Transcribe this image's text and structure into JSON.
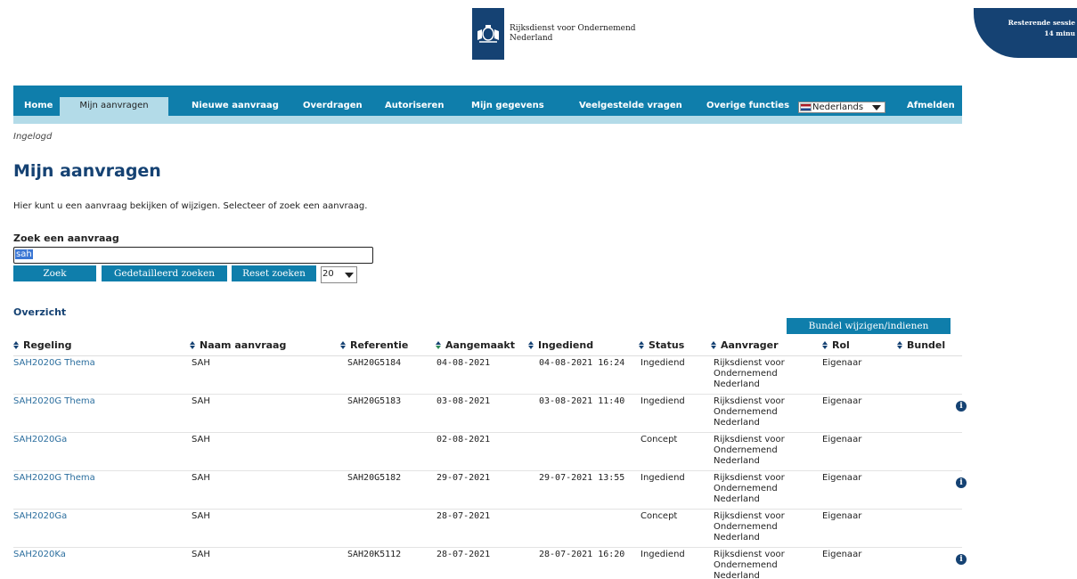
{
  "header": {
    "logo_line1": "Rijksdienst voor Ondernemend",
    "logo_line2": "Nederland",
    "session_line1": "Resterende sessie",
    "session_line2": "14 minu"
  },
  "nav": {
    "items": [
      "Home",
      "Mijn aanvragen",
      "Nieuwe aanvraag",
      "Overdragen",
      "Autoriseren",
      "Mijn gegevens",
      "Veelgestelde vragen",
      "Overige functies",
      "Afmelden"
    ],
    "language": "Nederlands"
  },
  "status": {
    "logged_in": "Ingelogd"
  },
  "page": {
    "title": "Mijn aanvragen",
    "intro": "Hier kunt u een aanvraag bekijken of wijzigen. Selecteer of zoek een aanvraag."
  },
  "search": {
    "label": "Zoek een aanvraag",
    "value": "sah",
    "search_button": "Zoek",
    "detailed_button": "Gedetailleerd zoeken",
    "reset_button": "Reset zoeken",
    "per_page": "20"
  },
  "overview": {
    "title": "Overzicht",
    "bundle_button": "Bundel wijzigen/indienen",
    "columns": [
      "Regeling",
      "Naam aanvraag",
      "Referentie",
      "Aangemaakt",
      "Ingediend",
      "Status",
      "Aanvrager",
      "Rol",
      "Bundel"
    ],
    "rows": [
      {
        "regeling": "SAH2020G Thema",
        "naam": "SAH",
        "referentie": "SAH20G5184",
        "aangemaakt": "04-08-2021",
        "ingediend": "04-08-2021 16:24",
        "status": "Ingediend",
        "aanvrager": "Rijksdienst voor Ondernemend Nederland",
        "rol": "Eigenaar",
        "info": ""
      },
      {
        "regeling": "SAH2020G Thema",
        "naam": "SAH",
        "referentie": "SAH20G5183",
        "aangemaakt": "03-08-2021",
        "ingediend": "03-08-2021 11:40",
        "status": "Ingediend",
        "aanvrager": "Rijksdienst voor Ondernemend Nederland",
        "rol": "Eigenaar",
        "info": "i"
      },
      {
        "regeling": "SAH2020Ga",
        "naam": "SAH",
        "referentie": "",
        "aangemaakt": "02-08-2021",
        "ingediend": "",
        "status": "Concept",
        "aanvrager": "Rijksdienst voor Ondernemend Nederland",
        "rol": "Eigenaar",
        "info": ""
      },
      {
        "regeling": "SAH2020G Thema",
        "naam": "SAH",
        "referentie": "SAH20G5182",
        "aangemaakt": "29-07-2021",
        "ingediend": "29-07-2021 13:55",
        "status": "Ingediend",
        "aanvrager": "Rijksdienst voor Ondernemend Nederland",
        "rol": "Eigenaar",
        "info": "i"
      },
      {
        "regeling": "SAH2020Ga",
        "naam": "SAH",
        "referentie": "",
        "aangemaakt": "28-07-2021",
        "ingediend": "",
        "status": "Concept",
        "aanvrager": "Rijksdienst voor Ondernemend Nederland",
        "rol": "Eigenaar",
        "info": ""
      },
      {
        "regeling": "SAH2020Ka",
        "naam": "SAH",
        "referentie": "SAH20K5112",
        "aangemaakt": "28-07-2021",
        "ingediend": "28-07-2021 16:20",
        "status": "Ingediend",
        "aanvrager": "Rijksdienst voor Ondernemend Nederland",
        "rol": "Eigenaar",
        "info": "i"
      }
    ]
  }
}
